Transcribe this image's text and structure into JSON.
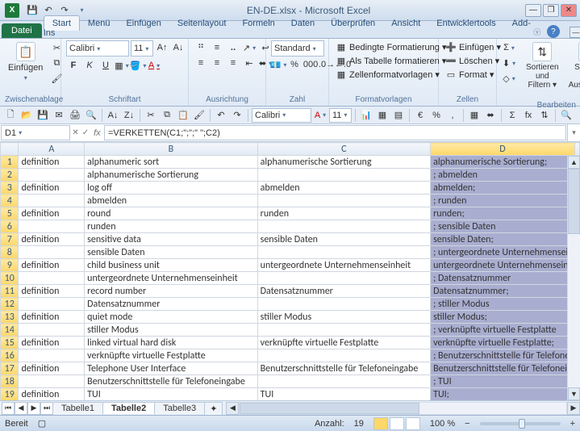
{
  "title": "EN-DE.xlsx - Microsoft Excel",
  "qat": {
    "save": "💾",
    "undo": "↶",
    "redo": "↷"
  },
  "tabs": {
    "file": "Datei",
    "items": [
      "Start",
      "Menü",
      "Einfügen",
      "Seitenlayout",
      "Formeln",
      "Daten",
      "Überprüfen",
      "Ansicht",
      "Entwicklertools",
      "Add-Ins"
    ],
    "active": 0
  },
  "ribbon": {
    "clipboard": {
      "paste": "Einfügen",
      "label": "Zwischenablage"
    },
    "font": {
      "name": "Calibri",
      "size": "11",
      "growShrink": [
        "A▲",
        "A▼"
      ],
      "btns1": [
        "F",
        "K",
        "U",
        "▭",
        "🪣",
        "A"
      ],
      "label": "Schriftart"
    },
    "align": {
      "label": "Ausrichtung"
    },
    "number": {
      "fmt": "Standard",
      "label": "Zahl"
    },
    "styles": {
      "cond": "Bedingte Formatierung ▾",
      "table": "Als Tabelle formatieren ▾",
      "cell": "Zellenformatvorlagen ▾",
      "label": "Formatvorlagen"
    },
    "cells": {
      "insert": "Einfügen ▾",
      "delete": "Löschen ▾",
      "format": "Format ▾",
      "label": "Zellen"
    },
    "editing": {
      "sort": "Sortieren und Filtern ▾",
      "find": "Suchen und Auswählen ▾",
      "label": "Bearbeiten"
    }
  },
  "toolbar2": {
    "font": "Calibri",
    "size": "11"
  },
  "namebox": "D1",
  "formula": "=VERKETTEN(C1;\";\";\" \";C2)",
  "columns": [
    "A",
    "B",
    "C",
    "D"
  ],
  "rows": [
    {
      "n": 1,
      "a": "definition",
      "b": "alphanumeric sort",
      "c": "alphanumerische Sortierung",
      "d": "alphanumerische Sortierung;"
    },
    {
      "n": 2,
      "a": "",
      "b": "alphanumerische Sortierung",
      "c": "",
      "d": "; abmelden"
    },
    {
      "n": 3,
      "a": "definition",
      "b": "log off",
      "c": "abmelden",
      "d": "abmelden;"
    },
    {
      "n": 4,
      "a": "",
      "b": "abmelden",
      "c": "",
      "d": "; runden"
    },
    {
      "n": 5,
      "a": "definition",
      "b": "round",
      "c": "runden",
      "d": "runden;"
    },
    {
      "n": 6,
      "a": "",
      "b": "runden",
      "c": "",
      "d": "; sensible Daten"
    },
    {
      "n": 7,
      "a": "definition",
      "b": "sensitive data",
      "c": "sensible Daten",
      "d": "sensible Daten;"
    },
    {
      "n": 8,
      "a": "",
      "b": "sensible Daten",
      "c": "",
      "d": "; untergeordnete Unternehmenseinheit"
    },
    {
      "n": 9,
      "a": "definition",
      "b": "child business unit",
      "c": "untergeordnete Unternehmenseinheit",
      "d": "untergeordnete Unternehmenseinheit;"
    },
    {
      "n": 10,
      "a": "",
      "b": "untergeordnete Unternehmenseinheit",
      "c": "",
      "d": "; Datensatznummer"
    },
    {
      "n": 11,
      "a": "definition",
      "b": "record number",
      "c": "Datensatznummer",
      "d": "Datensatznummer;"
    },
    {
      "n": 12,
      "a": "",
      "b": "Datensatznummer",
      "c": "",
      "d": "; stiller Modus"
    },
    {
      "n": 13,
      "a": "definition",
      "b": "quiet mode",
      "c": "stiller Modus",
      "d": "stiller Modus;"
    },
    {
      "n": 14,
      "a": "",
      "b": "stiller Modus",
      "c": "",
      "d": "; verknüpfte virtuelle Festplatte"
    },
    {
      "n": 15,
      "a": "definition",
      "b": "linked virtual hard disk",
      "c": "verknüpfte virtuelle Festplatte",
      "d": "verknüpfte virtuelle Festplatte;"
    },
    {
      "n": 16,
      "a": "",
      "b": "verknüpfte virtuelle Festplatte",
      "c": "",
      "d": "; Benutzerschnittstelle für Telefoneingabe"
    },
    {
      "n": 17,
      "a": "definition",
      "b": "Telephone User Interface",
      "c": "Benutzerschnittstelle für Telefoneingabe",
      "d": "Benutzerschnittstelle für Telefoneingabe"
    },
    {
      "n": 18,
      "a": "",
      "b": "Benutzerschnittstelle für Telefoneingabe",
      "c": "",
      "d": "; TUI"
    },
    {
      "n": 19,
      "a": "definition",
      "b": "TUI",
      "c": "TUI",
      "d": "TUI;"
    }
  ],
  "sheets": {
    "items": [
      "Tabelle1",
      "Tabelle2",
      "Tabelle3"
    ],
    "active": 1
  },
  "status": {
    "ready": "Bereit",
    "count_lbl": "Anzahl:",
    "count": "19",
    "zoom": "100 %"
  }
}
